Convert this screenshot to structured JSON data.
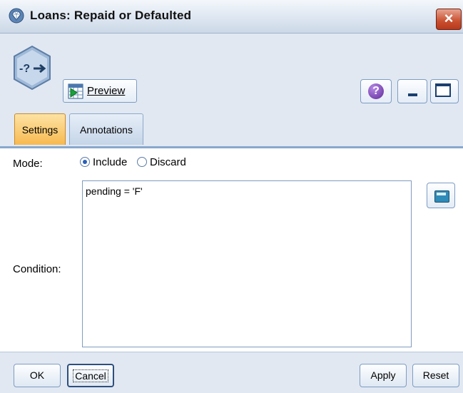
{
  "window": {
    "title": "Loans: Repaid or Defaulted",
    "close_label": "×"
  },
  "toolbar": {
    "preview_label": "Preview",
    "help_glyph": "?"
  },
  "tabs": [
    {
      "label": "Settings",
      "active": true
    },
    {
      "label": "Annotations",
      "active": false
    }
  ],
  "settings": {
    "mode_label": "Mode:",
    "mode_options": [
      {
        "label": "Include",
        "checked": true
      },
      {
        "label": "Discard",
        "checked": false
      }
    ],
    "condition_label": "Condition:",
    "condition_value": "pending = 'F'"
  },
  "footer": {
    "ok_label": "OK",
    "cancel_label": "Cancel",
    "apply_label": "Apply",
    "reset_label": "Reset"
  },
  "colors": {
    "active_tab": "#f7b94f",
    "accent": "#2a5fb8"
  }
}
